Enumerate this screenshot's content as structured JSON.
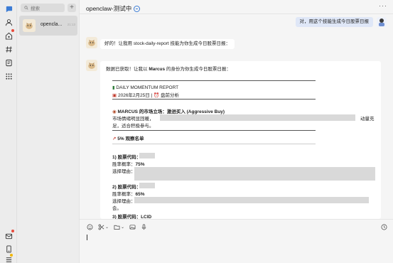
{
  "search": {
    "placeholder": "搜索"
  },
  "session": {
    "name": "opencla...",
    "time": "21:13"
  },
  "chat": {
    "title": "openclaw-测试中",
    "user_message": "对，用这个技能生成今日股票日报",
    "bot_message_1": "好的！让我用 stock-daily-report 技能为你生成今日股票日报：",
    "bot_message_2_prefix": "数据已获取！让我以 ",
    "bot_message_2_name": "Marcus",
    "bot_message_2_suffix": " 的身份为你生成今日股票日报："
  },
  "report": {
    "header": "DAILY MOMENTUM REPORT",
    "date_line": "2026年2月25日 | ⏰ 盘前分析",
    "stance": "MARCUS 的市场立场：激进买入 (Aggressive Buy)",
    "sentiment_prefix": "市场情绪明显回暖，",
    "sentiment_suffix": "动量充",
    "sentiment_line2": "足，适合积极参与。",
    "watchlist_title": "5% 观察名单",
    "item1_title": "1) 股票代码：",
    "item1_winrate_label": "胜率概率：",
    "item1_winrate": "75%",
    "item1_reason": "选择理由：",
    "item2_title": "2) 股票代码：",
    "item2_winrate_label": "胜率概率：",
    "item2_winrate": "65%",
    "item2_reason": "选择理由：",
    "item2_tail": "会。",
    "item3_title_partial": "3) 股票代码：LCID"
  },
  "icons": {
    "rail": [
      "chat-icon",
      "contacts-icon",
      "discover-icon",
      "topics-icon",
      "docs-icon",
      "apps-icon",
      "mail-icon",
      "phone-icon",
      "menu-icon"
    ],
    "toolbar": [
      "emoji-icon",
      "scissors-icon",
      "folder-icon",
      "image-icon",
      "mic-icon",
      "history-icon"
    ]
  },
  "colors": {
    "accent": "#3a7bd5",
    "badge": "#e84b3c",
    "user_bubble": "#dfe7f7"
  }
}
